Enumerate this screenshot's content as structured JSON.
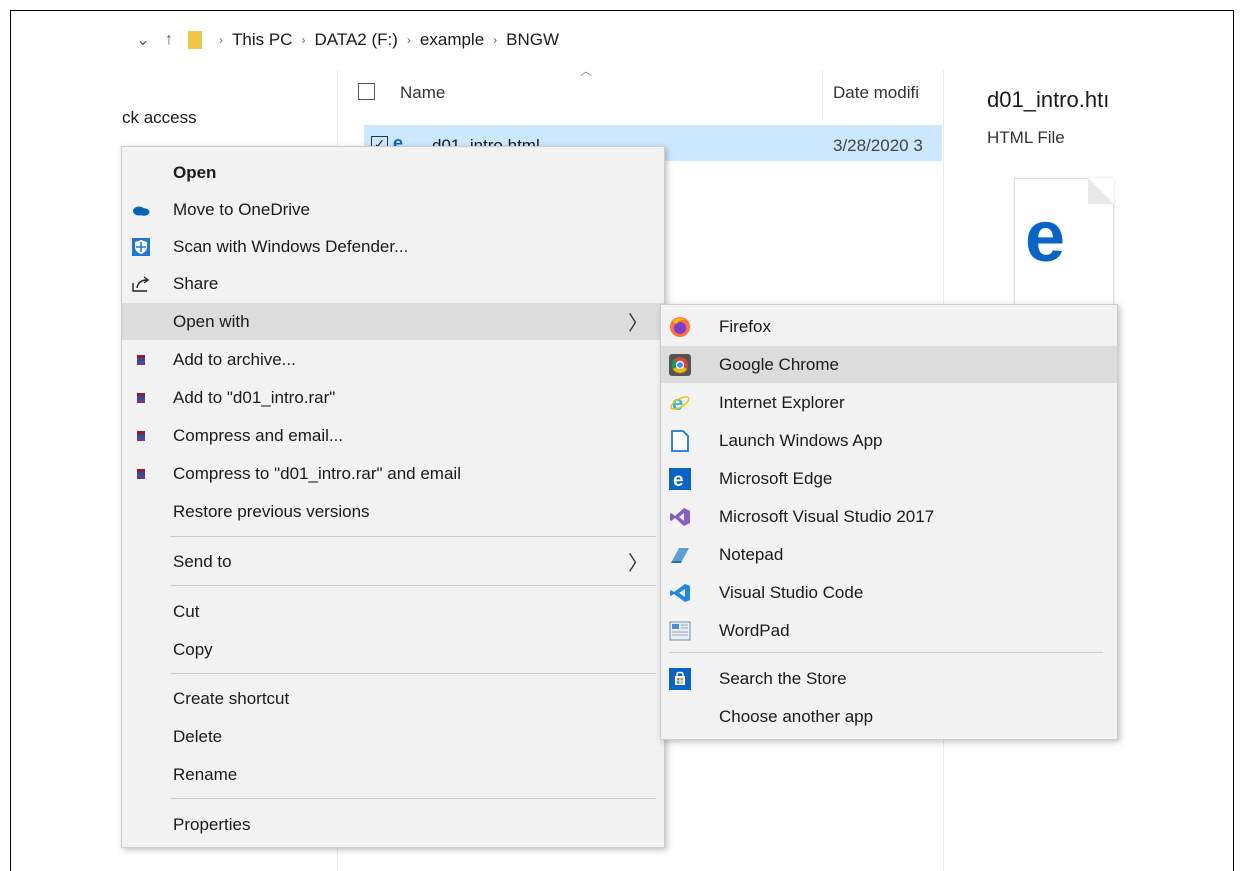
{
  "breadcrumb": {
    "down_icon": "⌄",
    "up_icon": "↑",
    "parts": [
      "This PC",
      "DATA2 (F:)",
      "example",
      "BNGW"
    ],
    "sep": "›"
  },
  "nav": {
    "quick_access": "ck access"
  },
  "columns": {
    "name": "Name",
    "date": "Date modifi"
  },
  "file": {
    "check": "✓",
    "name": "d01_intro.html",
    "date": "3/28/2020 3"
  },
  "preview": {
    "title": "d01_intro.htı",
    "type": "HTML File"
  },
  "context_menu": {
    "items": [
      {
        "label": "Open",
        "icon": "none"
      },
      {
        "label": "Move to OneDrive",
        "icon": "onedrive-icon"
      },
      {
        "label": "Scan with Windows Defender...",
        "icon": "defender-icon"
      },
      {
        "label": "Share",
        "icon": "share-icon"
      },
      {
        "label": "Open with",
        "icon": "none"
      },
      {
        "label": "Add to archive...",
        "icon": "winrar-icon"
      },
      {
        "label": "Add to \"d01_intro.rar\"",
        "icon": "winrar-icon"
      },
      {
        "label": "Compress and email...",
        "icon": "winrar-icon"
      },
      {
        "label": "Compress to \"d01_intro.rar\" and email",
        "icon": "winrar-icon"
      },
      {
        "label": "Restore previous versions",
        "icon": "none"
      },
      {
        "label": "Send to",
        "icon": "none"
      },
      {
        "label": "Cut",
        "icon": "none"
      },
      {
        "label": "Copy",
        "icon": "none"
      },
      {
        "label": "Create shortcut",
        "icon": "none"
      },
      {
        "label": "Delete",
        "icon": "none"
      },
      {
        "label": "Rename",
        "icon": "none"
      },
      {
        "label": "Properties",
        "icon": "none"
      }
    ],
    "submenu_arrow": "〉"
  },
  "open_with": {
    "items": [
      {
        "label": "Firefox",
        "icon": "firefox-icon"
      },
      {
        "label": "Google Chrome",
        "icon": "chrome-icon"
      },
      {
        "label": "Internet Explorer",
        "icon": "ie-icon"
      },
      {
        "label": "Launch Windows App",
        "icon": "app-icon"
      },
      {
        "label": "Microsoft Edge",
        "icon": "edge-icon"
      },
      {
        "label": "Microsoft Visual Studio 2017",
        "icon": "visual-studio-icon"
      },
      {
        "label": "Notepad",
        "icon": "notepad-icon"
      },
      {
        "label": "Visual Studio Code",
        "icon": "vscode-icon"
      },
      {
        "label": "WordPad",
        "icon": "wordpad-icon"
      },
      {
        "label": "Search the Store",
        "icon": "store-icon"
      },
      {
        "label": "Choose another app",
        "icon": "none"
      }
    ]
  },
  "colors": {
    "selection": "#cce8ff",
    "menu_bg": "#f2f2f2",
    "highlight": "#dcdcdc",
    "accent": "#0a64c8"
  }
}
